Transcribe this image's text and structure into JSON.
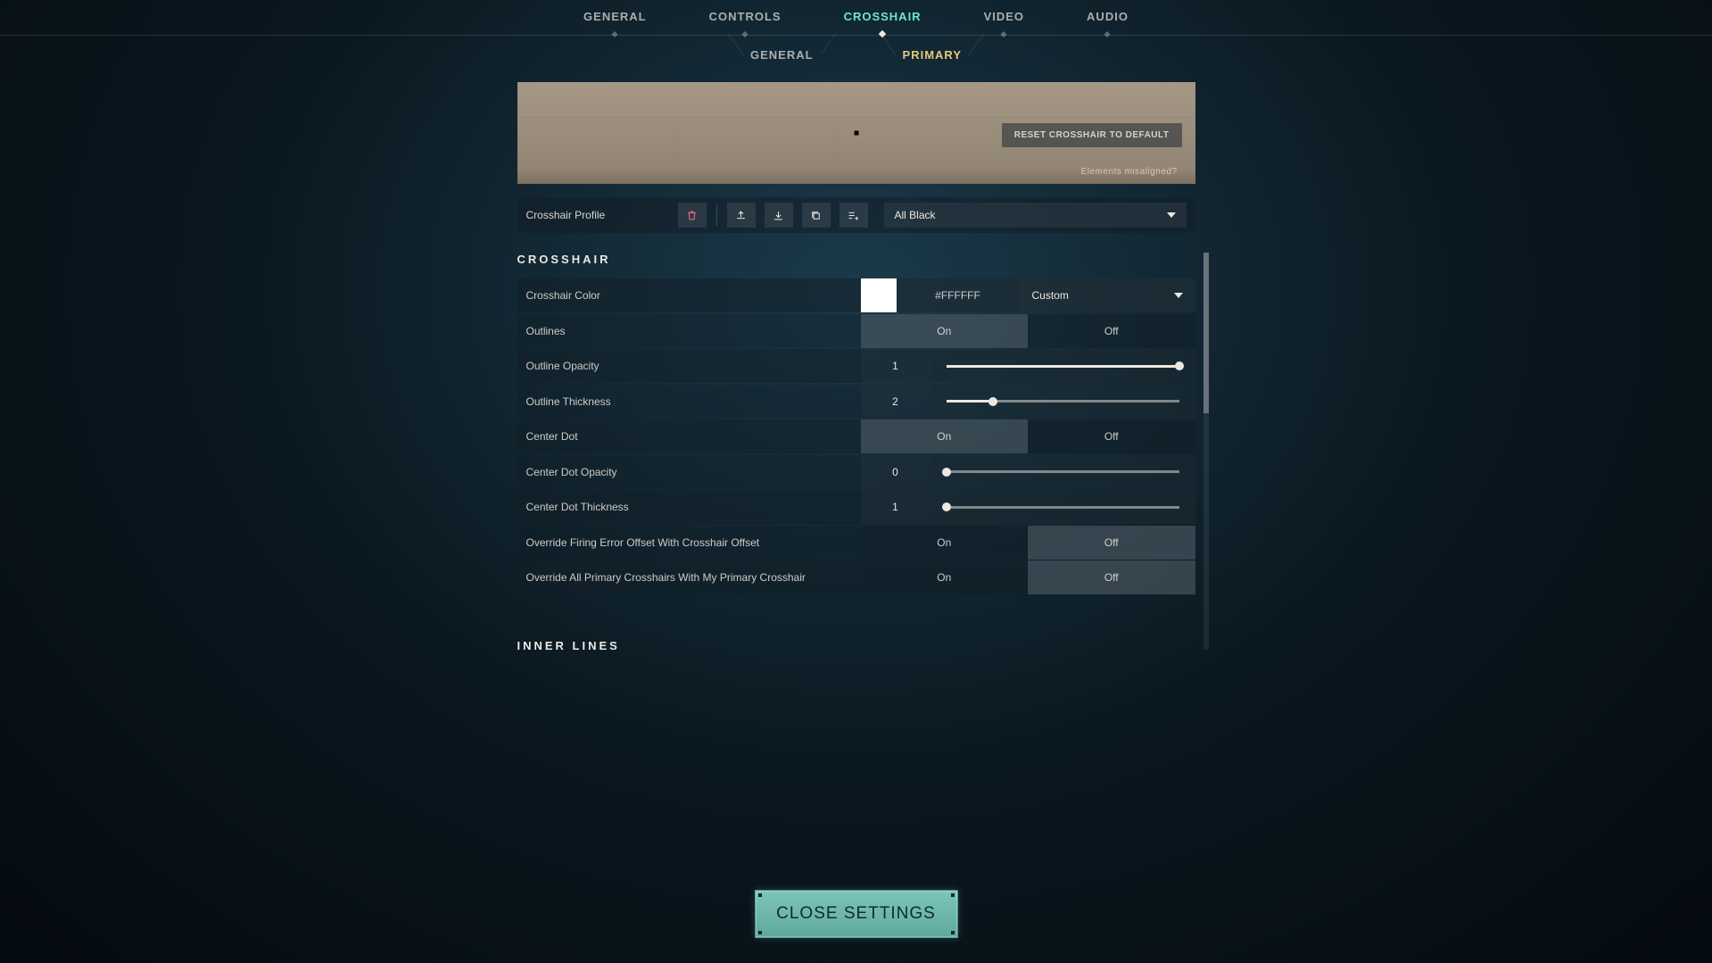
{
  "main_tabs": {
    "general": "GENERAL",
    "controls": "CONTROLS",
    "crosshair": "CROSSHAIR",
    "video": "VIDEO",
    "audio": "AUDIO"
  },
  "sub_tabs": {
    "general": "GENERAL",
    "primary": "PRIMARY"
  },
  "preview": {
    "reset_label": "RESET CROSSHAIR TO DEFAULT",
    "misaligned_label": "Elements misaligned?"
  },
  "profile": {
    "label": "Crosshair Profile",
    "selected": "All Black"
  },
  "section": {
    "crosshair_heading": "CROSSHAIR",
    "inner_lines_heading": "INNER LINES"
  },
  "labels": {
    "on": "On",
    "off": "Off"
  },
  "rows": {
    "crosshair_color": {
      "label": "Crosshair Color",
      "hex": "#FFFFFF",
      "mode": "Custom"
    },
    "outlines": {
      "label": "Outlines",
      "value": "On"
    },
    "outline_opacity": {
      "label": "Outline Opacity",
      "value": "1",
      "pct": 100
    },
    "outline_thickness": {
      "label": "Outline Thickness",
      "value": "2",
      "pct": 20
    },
    "center_dot": {
      "label": "Center Dot",
      "value": "On"
    },
    "center_dot_opacity": {
      "label": "Center Dot Opacity",
      "value": "0",
      "pct": 0
    },
    "center_dot_thickness": {
      "label": "Center Dot Thickness",
      "value": "1",
      "pct": 0
    },
    "override_firing": {
      "label": "Override Firing Error Offset With Crosshair Offset",
      "value": "Off"
    },
    "override_all_primary": {
      "label": "Override All Primary Crosshairs With My Primary Crosshair",
      "value": "Off"
    }
  },
  "close_label": "CLOSE SETTINGS"
}
